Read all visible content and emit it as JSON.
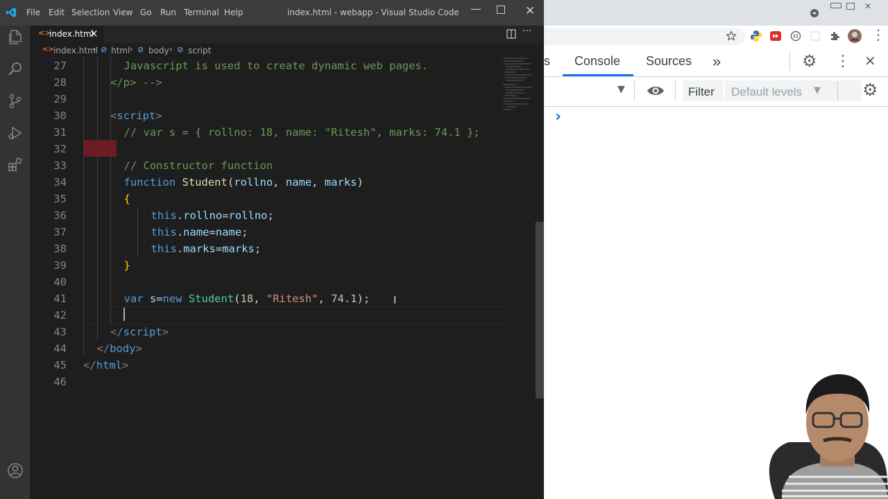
{
  "window": {
    "title": "index.html - webapp - Visual Studio Code"
  },
  "menu": [
    "File",
    "Edit",
    "Selection",
    "View",
    "Go",
    "Run",
    "Terminal",
    "Help"
  ],
  "tab": {
    "label": "index.html",
    "close": "×"
  },
  "breadcrumb": [
    "index.html",
    "html",
    "body",
    "script"
  ],
  "editor": {
    "lines": [
      {
        "n": "27",
        "indent": 3,
        "parts": [
          [
            "Javascript is used to create dynamic web pages.",
            "#6a9955"
          ]
        ]
      },
      {
        "n": "28",
        "indent": 2,
        "parts": [
          [
            "</p> -->",
            "#6a9955"
          ]
        ]
      },
      {
        "n": "29",
        "indent": 0,
        "parts": []
      },
      {
        "n": "30",
        "indent": 2,
        "parts": [
          [
            "<",
            "#808080"
          ],
          [
            "script",
            "#569cd6"
          ],
          [
            ">",
            "#808080"
          ]
        ]
      },
      {
        "n": "31",
        "indent": 3,
        "parts": [
          [
            "// var s = { rollno: 18, name: \"Ritesh\", marks: 74.1 };",
            "#6a9955"
          ]
        ]
      },
      {
        "n": "32",
        "indent": 0,
        "parts": []
      },
      {
        "n": "33",
        "indent": 3,
        "parts": [
          [
            "// Constructor function",
            "#6a9955"
          ]
        ]
      },
      {
        "n": "34",
        "indent": 3,
        "parts": [
          [
            "function ",
            "#569cd6"
          ],
          [
            "Student",
            "#dcdcaa"
          ],
          [
            "(",
            "#d4d4d4"
          ],
          [
            "rollno",
            "#9cdcfe"
          ],
          [
            ", ",
            "#d4d4d4"
          ],
          [
            "name",
            "#9cdcfe"
          ],
          [
            ", ",
            "#d4d4d4"
          ],
          [
            "marks",
            "#9cdcfe"
          ],
          [
            ")",
            "#d4d4d4"
          ]
        ]
      },
      {
        "n": "35",
        "indent": 3,
        "parts": [
          [
            "{",
            "#ffd700"
          ]
        ]
      },
      {
        "n": "36",
        "indent": 5,
        "parts": [
          [
            "this",
            "#569cd6"
          ],
          [
            ".",
            "#d4d4d4"
          ],
          [
            "rollno",
            "#9cdcfe"
          ],
          [
            "=",
            "#d4d4d4"
          ],
          [
            "rollno",
            "#9cdcfe"
          ],
          [
            ";",
            "#d4d4d4"
          ]
        ]
      },
      {
        "n": "37",
        "indent": 5,
        "parts": [
          [
            "this",
            "#569cd6"
          ],
          [
            ".",
            "#d4d4d4"
          ],
          [
            "name",
            "#9cdcfe"
          ],
          [
            "=",
            "#d4d4d4"
          ],
          [
            "name",
            "#9cdcfe"
          ],
          [
            ";",
            "#d4d4d4"
          ]
        ]
      },
      {
        "n": "38",
        "indent": 5,
        "parts": [
          [
            "this",
            "#569cd6"
          ],
          [
            ".",
            "#d4d4d4"
          ],
          [
            "marks",
            "#9cdcfe"
          ],
          [
            "=",
            "#d4d4d4"
          ],
          [
            "marks",
            "#9cdcfe"
          ],
          [
            ";",
            "#d4d4d4"
          ]
        ]
      },
      {
        "n": "39",
        "indent": 3,
        "parts": [
          [
            "}",
            "#ffd700"
          ]
        ]
      },
      {
        "n": "40",
        "indent": 0,
        "parts": []
      },
      {
        "n": "41",
        "indent": 3,
        "parts": [
          [
            "var ",
            "#569cd6"
          ],
          [
            "s",
            "#9cdcfe"
          ],
          [
            "=",
            "#d4d4d4"
          ],
          [
            "new ",
            "#569cd6"
          ],
          [
            "Student",
            "#4ec9b0"
          ],
          [
            "(",
            "#d4d4d4"
          ],
          [
            "18",
            "#b5cea8"
          ],
          [
            ", ",
            "#d4d4d4"
          ],
          [
            "\"Ritesh\"",
            "#ce9178"
          ],
          [
            ", ",
            "#d4d4d4"
          ],
          [
            "74.1",
            "#b5cea8"
          ],
          [
            ");",
            "#d4d4d4"
          ]
        ]
      },
      {
        "n": "42",
        "indent": 0,
        "parts": []
      },
      {
        "n": "43",
        "indent": 2,
        "parts": [
          [
            "</",
            "#808080"
          ],
          [
            "script",
            "#569cd6"
          ],
          [
            ">",
            "#808080"
          ]
        ]
      },
      {
        "n": "44",
        "indent": 1,
        "parts": [
          [
            "</",
            "#808080"
          ],
          [
            "body",
            "#569cd6"
          ],
          [
            ">",
            "#808080"
          ]
        ]
      },
      {
        "n": "45",
        "indent": 0,
        "parts": [
          [
            "</",
            "#808080"
          ],
          [
            "html",
            "#569cd6"
          ],
          [
            ">",
            "#808080"
          ]
        ]
      },
      {
        "n": "46",
        "indent": 0,
        "parts": []
      }
    ]
  },
  "devtools": {
    "tabs": [
      "s",
      "Console",
      "Sources"
    ],
    "active_tab": "Console",
    "filter_label": "Filter",
    "levels_label": "Default levels",
    "prompt": "›"
  },
  "colors": {
    "accent": "#1a73e8",
    "titlebar": "#3c3c3c",
    "editor_bg": "#1e1e1e"
  }
}
